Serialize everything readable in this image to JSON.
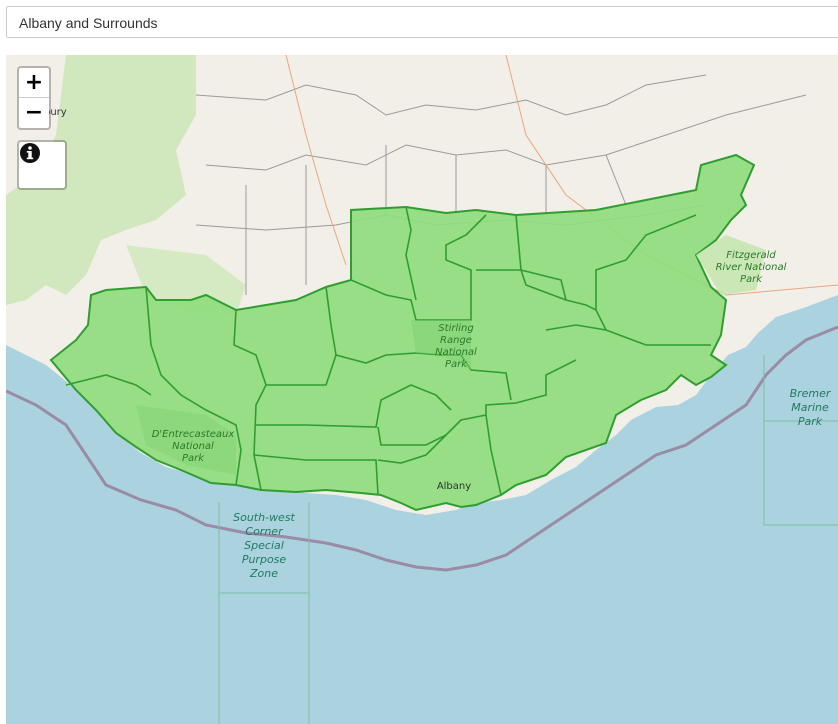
{
  "search": {
    "value": "Albany and Surrounds"
  },
  "zoom": {
    "in_label": "+",
    "out_label": "−"
  },
  "info": {
    "icon": "info-circle-icon"
  },
  "map_labels": {
    "fitzgerald": [
      "Fitzgerald",
      "River National",
      "Park"
    ],
    "stirling": [
      "Stirling",
      "Range",
      "National",
      "Park"
    ],
    "dentrecasteaux": [
      "D'Entrecasteaux",
      "National",
      "Park"
    ],
    "bremer": [
      "Bremer",
      "Marine",
      "Park"
    ],
    "southwest": [
      "South-west",
      "Corner",
      "Special",
      "Purpose",
      "Zone"
    ],
    "albany": "Albany",
    "bury": "bury"
  },
  "colors": {
    "sea": "#aad3df",
    "land": "#f2efe9",
    "region_fill": "#8fdc7e",
    "region_border": "#2f9e2f",
    "park": "#c8e6b0"
  }
}
